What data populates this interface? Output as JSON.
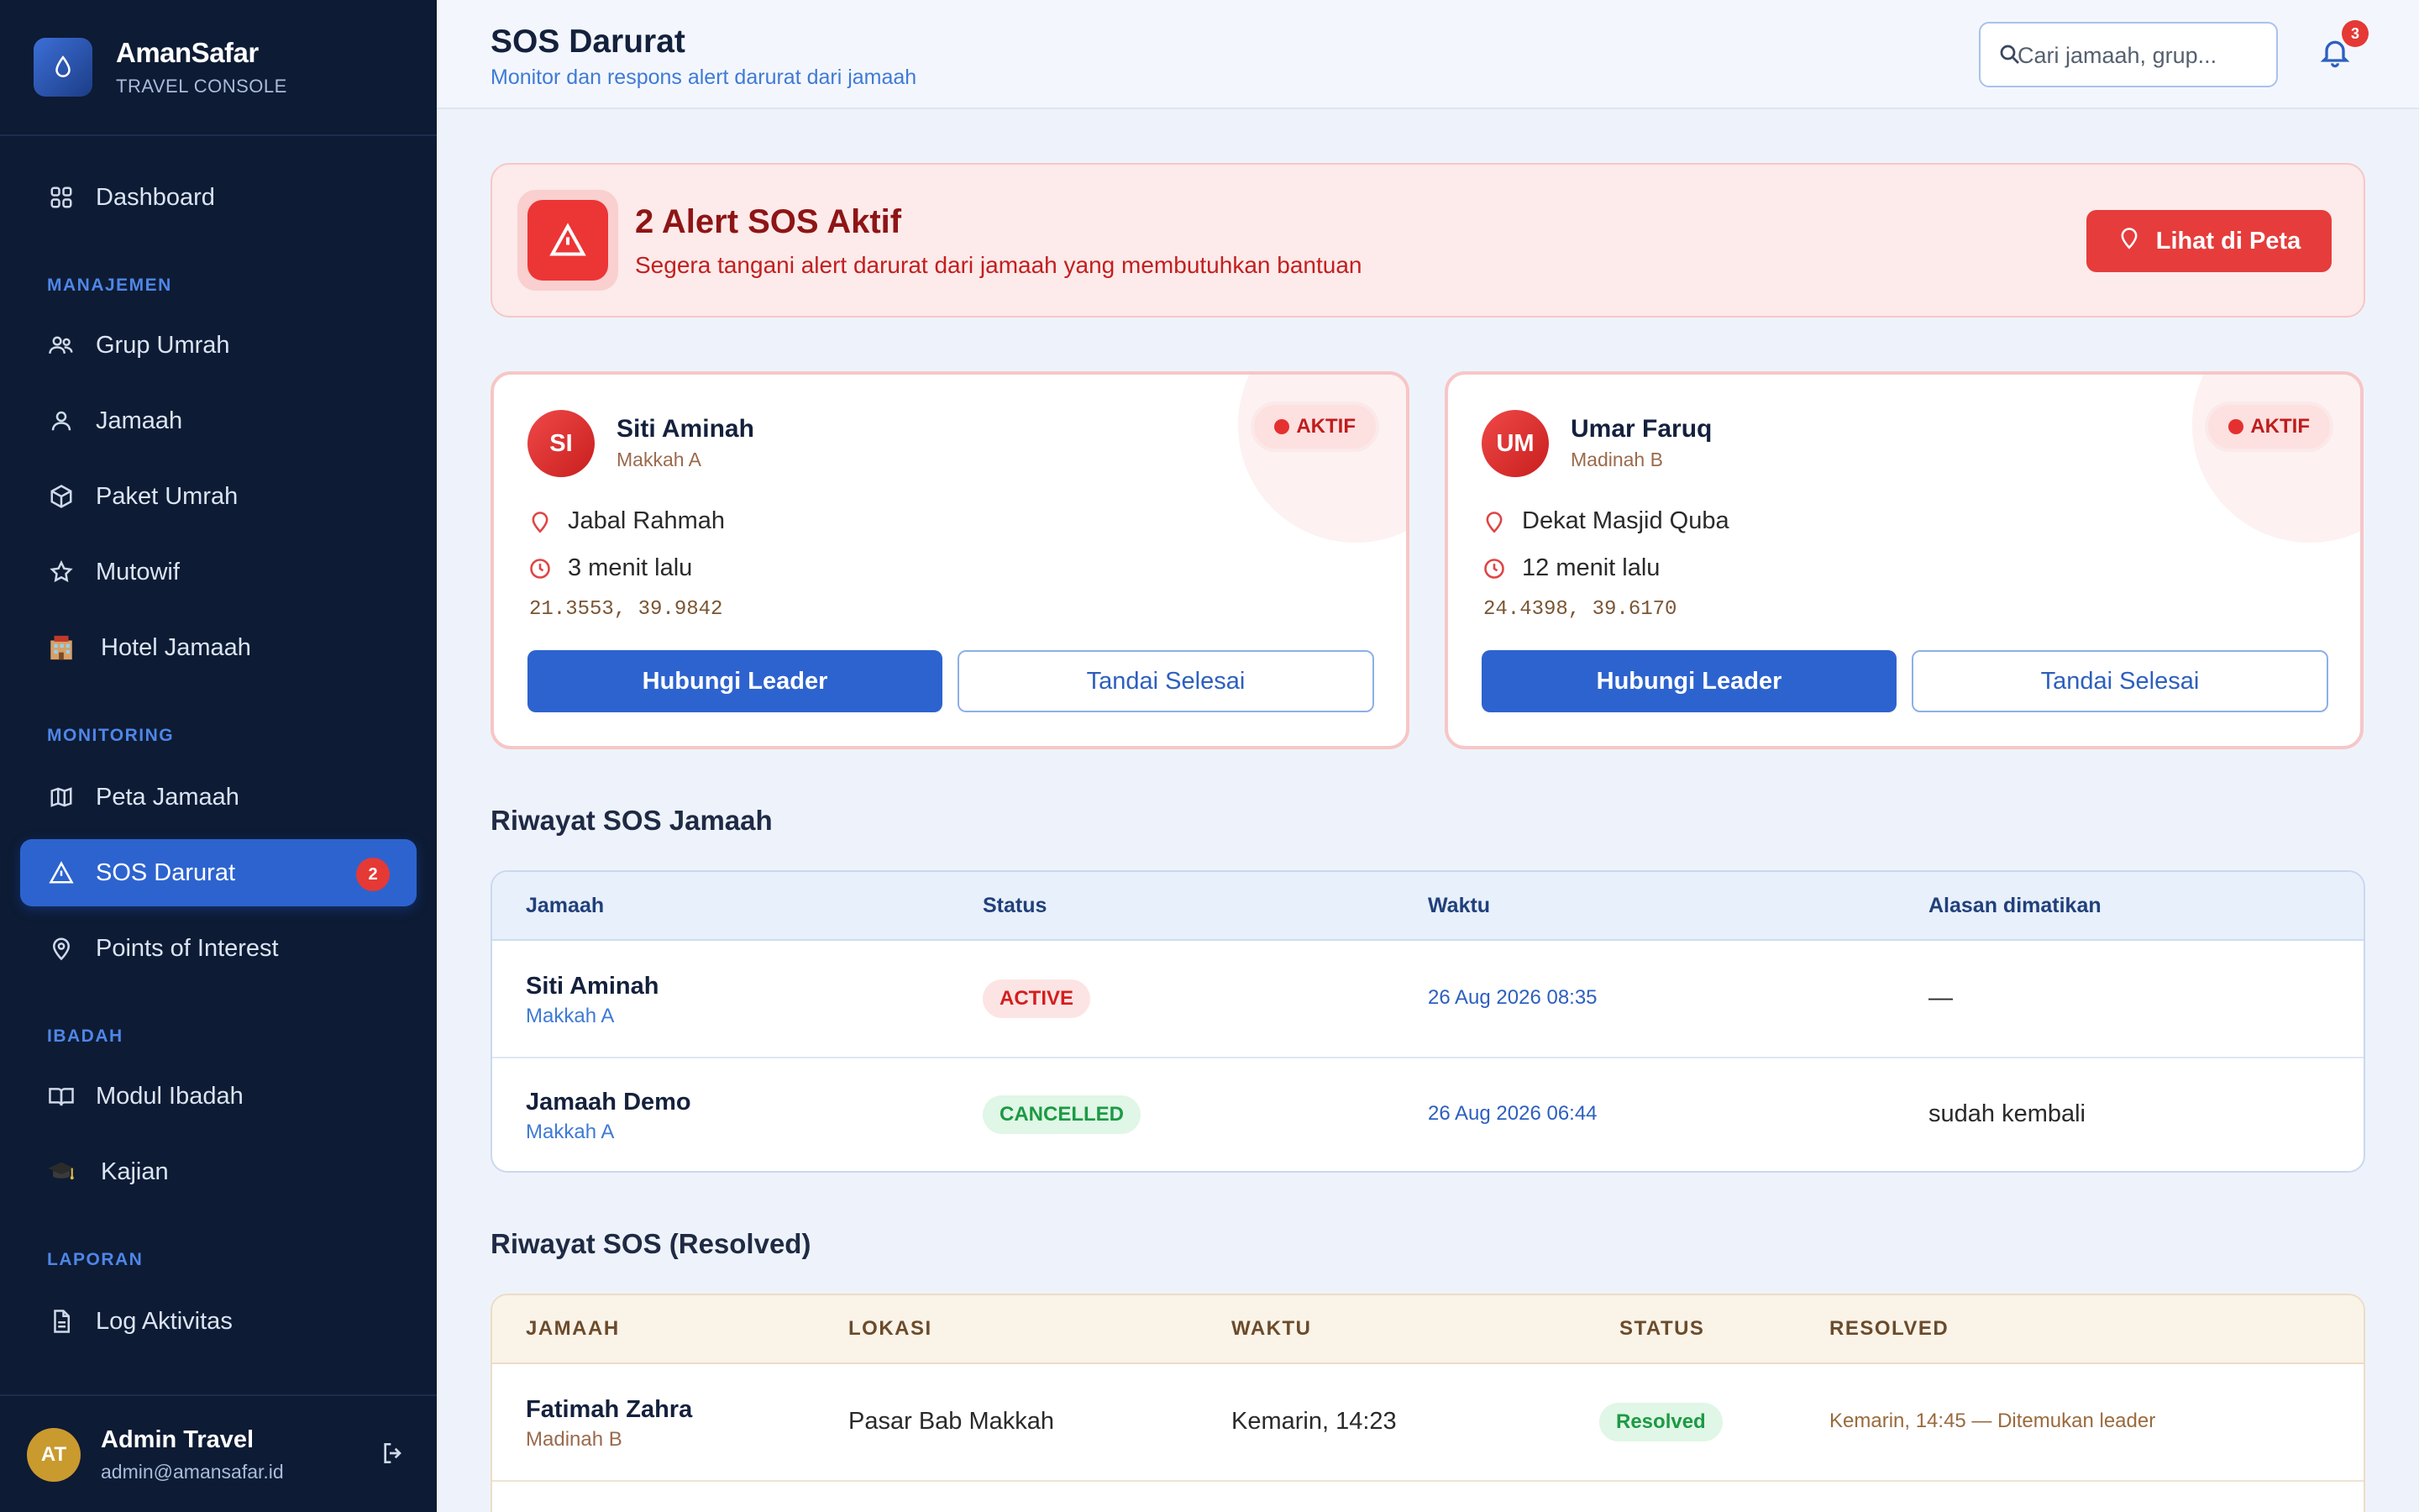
{
  "brand": {
    "name": "AmanSafar",
    "subtitle": "TRAVEL CONSOLE"
  },
  "sidebar": {
    "dashboard": "Dashboard",
    "sections": {
      "manajemen": "MANAJEMEN",
      "monitoring": "MONITORING",
      "ibadah": "IBADAH",
      "laporan": "LAPORAN"
    },
    "items": {
      "grup_umrah": "Grup Umrah",
      "jamaah": "Jamaah",
      "paket_umrah": "Paket Umrah",
      "mutowif": "Mutowif",
      "hotel_jamaah": "Hotel Jamaah",
      "peta_jamaah": "Peta Jamaah",
      "sos_darurat": "SOS Darurat",
      "sos_badge": "2",
      "points_of_interest": "Points of Interest",
      "modul_ibadah": "Modul Ibadah",
      "kajian": "Kajian",
      "log_aktivitas": "Log Aktivitas"
    },
    "active_item": "SOS Darurat",
    "user": {
      "initials": "AT",
      "name": "Admin Travel",
      "email": "admin@amansafar.id"
    }
  },
  "header": {
    "title": "SOS Darurat",
    "subtitle": "Monitor dan respons alert darurat dari jamaah",
    "search_placeholder": "Cari jamaah, grup...",
    "notification_count": "3"
  },
  "banner": {
    "title": "2 Alert SOS Aktif",
    "subtitle": "Segera tangani alert darurat dari jamaah yang membutuhkan bantuan",
    "map_button": "Lihat di Peta"
  },
  "active_alerts": [
    {
      "initials": "SI",
      "name": "Siti Aminah",
      "group": "Makkah A",
      "status": "AKTIF",
      "location": "Jabal Rahmah",
      "time_ago": "3 menit lalu",
      "coords": "21.3553, 39.9842",
      "contact_button": "Hubungi Leader",
      "resolve_button": "Tandai Selesai"
    },
    {
      "initials": "UM",
      "name": "Umar Faruq",
      "group": "Madinah B",
      "status": "AKTIF",
      "location": "Dekat Masjid Quba",
      "time_ago": "12 menit lalu",
      "coords": "24.4398, 39.6170",
      "contact_button": "Hubungi Leader",
      "resolve_button": "Tandai Selesai"
    }
  ],
  "history": {
    "title": "Riwayat SOS Jamaah",
    "columns": [
      "Jamaah",
      "Status",
      "Waktu",
      "Alasan dimatikan"
    ],
    "rows": [
      {
        "name": "Siti Aminah",
        "group": "Makkah A",
        "status": "ACTIVE",
        "time": "26 Aug 2026 08:35",
        "reason": "—"
      },
      {
        "name": "Jamaah Demo",
        "group": "Makkah A",
        "status": "CANCELLED",
        "time": "26 Aug 2026 06:44",
        "reason": "sudah kembali"
      }
    ]
  },
  "resolved": {
    "title": "Riwayat SOS (Resolved)",
    "columns": [
      "JAMAAH",
      "LOKASI",
      "WAKTU",
      "STATUS",
      "RESOLVED"
    ],
    "rows": [
      {
        "name": "Fatimah Zahra",
        "group": "Madinah B",
        "location": "Pasar Bab Makkah",
        "time": "Kemarin, 14:23",
        "status": "Resolved",
        "resolved": "Kemarin, 14:45 — Ditemukan leader"
      }
    ]
  },
  "colors": {
    "sidebar_bg": "#0d1b34",
    "primary": "#2d63cf",
    "danger": "#e63c3c",
    "success": "#1c9a44"
  }
}
